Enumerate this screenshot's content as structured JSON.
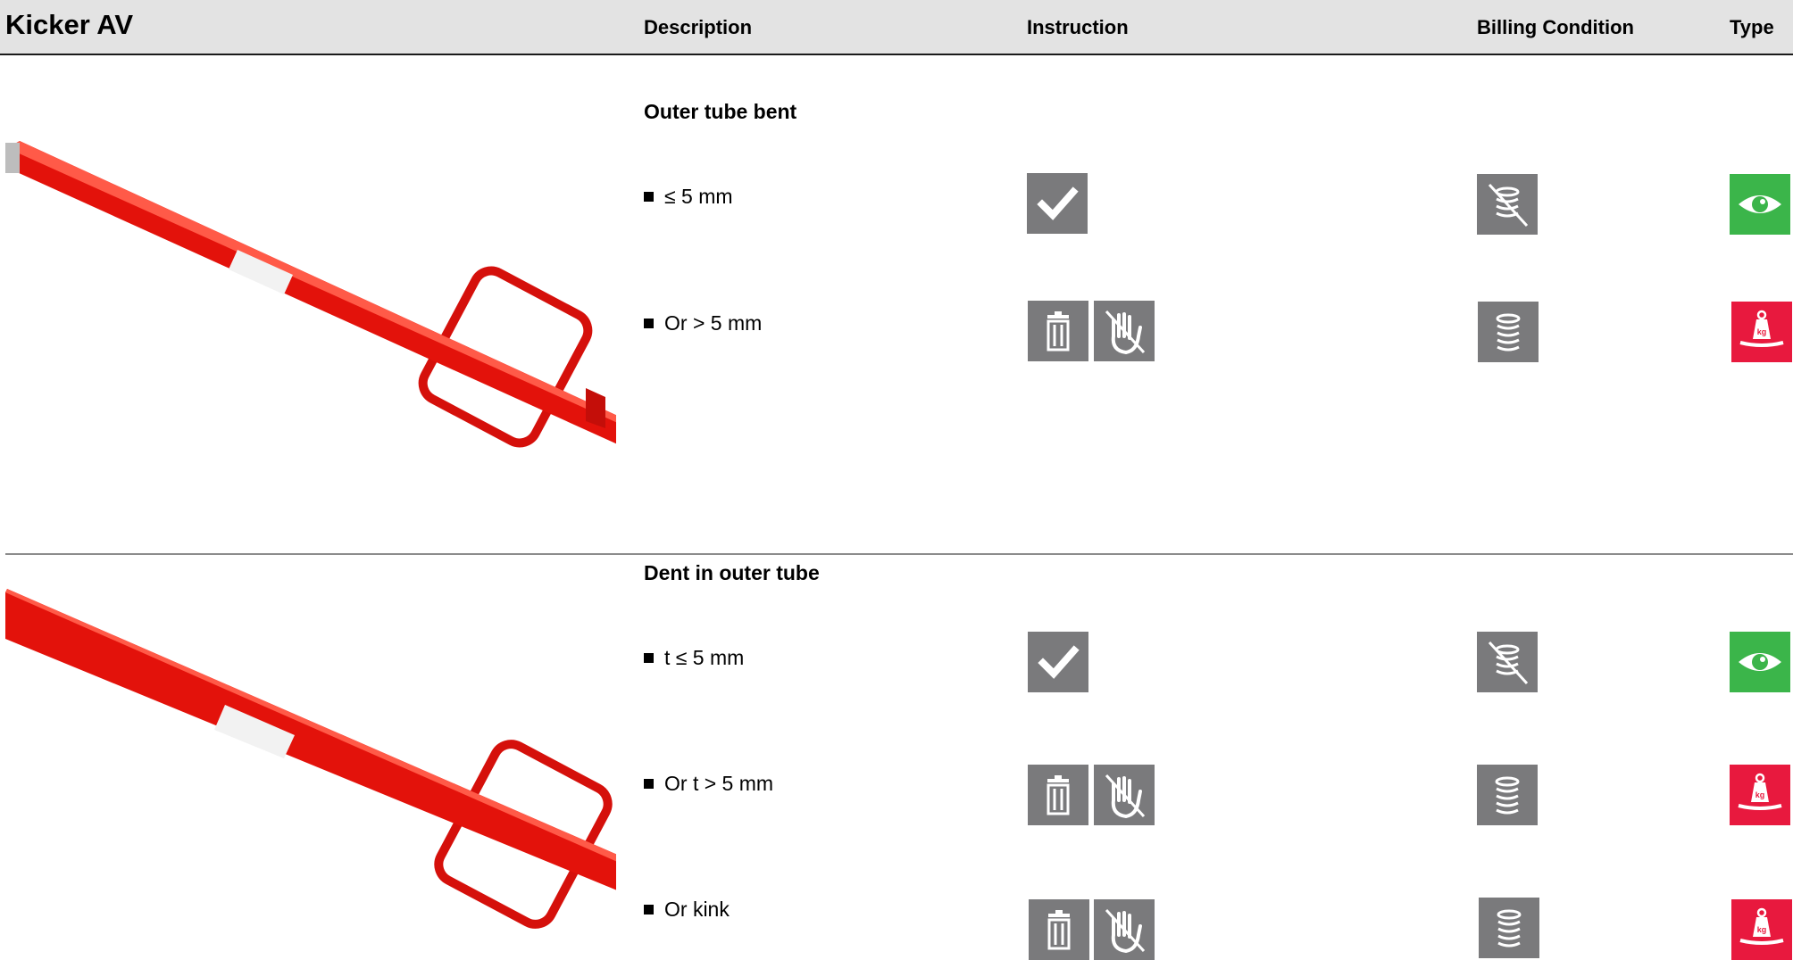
{
  "header": {
    "title": "Kicker AV",
    "columns": {
      "description": "Description",
      "instruction": "Instruction",
      "billing": "Billing Condition",
      "type": "Type"
    }
  },
  "sections": [
    {
      "title": "Outer tube bent",
      "rows": [
        {
          "label": "≤ 5 mm",
          "instruction": [
            "check-icon"
          ],
          "billing": "no-charge-coins-icon",
          "type": "visual-inspection-eye-icon"
        },
        {
          "label": "Or > 5 mm",
          "instruction": [
            "trash-icon",
            "do-not-repair-hand-icon"
          ],
          "billing": "charge-coins-icon",
          "type": "weight-kg-icon"
        }
      ]
    },
    {
      "title": "Dent in outer tube",
      "rows": [
        {
          "label": "t ≤ 5 mm",
          "instruction": [
            "check-icon"
          ],
          "billing": "no-charge-coins-icon",
          "type": "visual-inspection-eye-icon"
        },
        {
          "label": "Or t > 5 mm",
          "instruction": [
            "trash-icon",
            "do-not-repair-hand-icon"
          ],
          "billing": "charge-coins-icon",
          "type": "weight-kg-icon"
        },
        {
          "label": "Or kink",
          "instruction": [
            "trash-icon",
            "do-not-repair-hand-icon"
          ],
          "billing": "charge-coins-icon",
          "type": "weight-kg-icon"
        }
      ]
    }
  ],
  "colors": {
    "icon_grey": "#7a7a7c",
    "eye_green": "#3bb54a",
    "weight_red": "#e8193e",
    "product_red": "#e3120b",
    "header_bg": "#e3e3e3"
  }
}
